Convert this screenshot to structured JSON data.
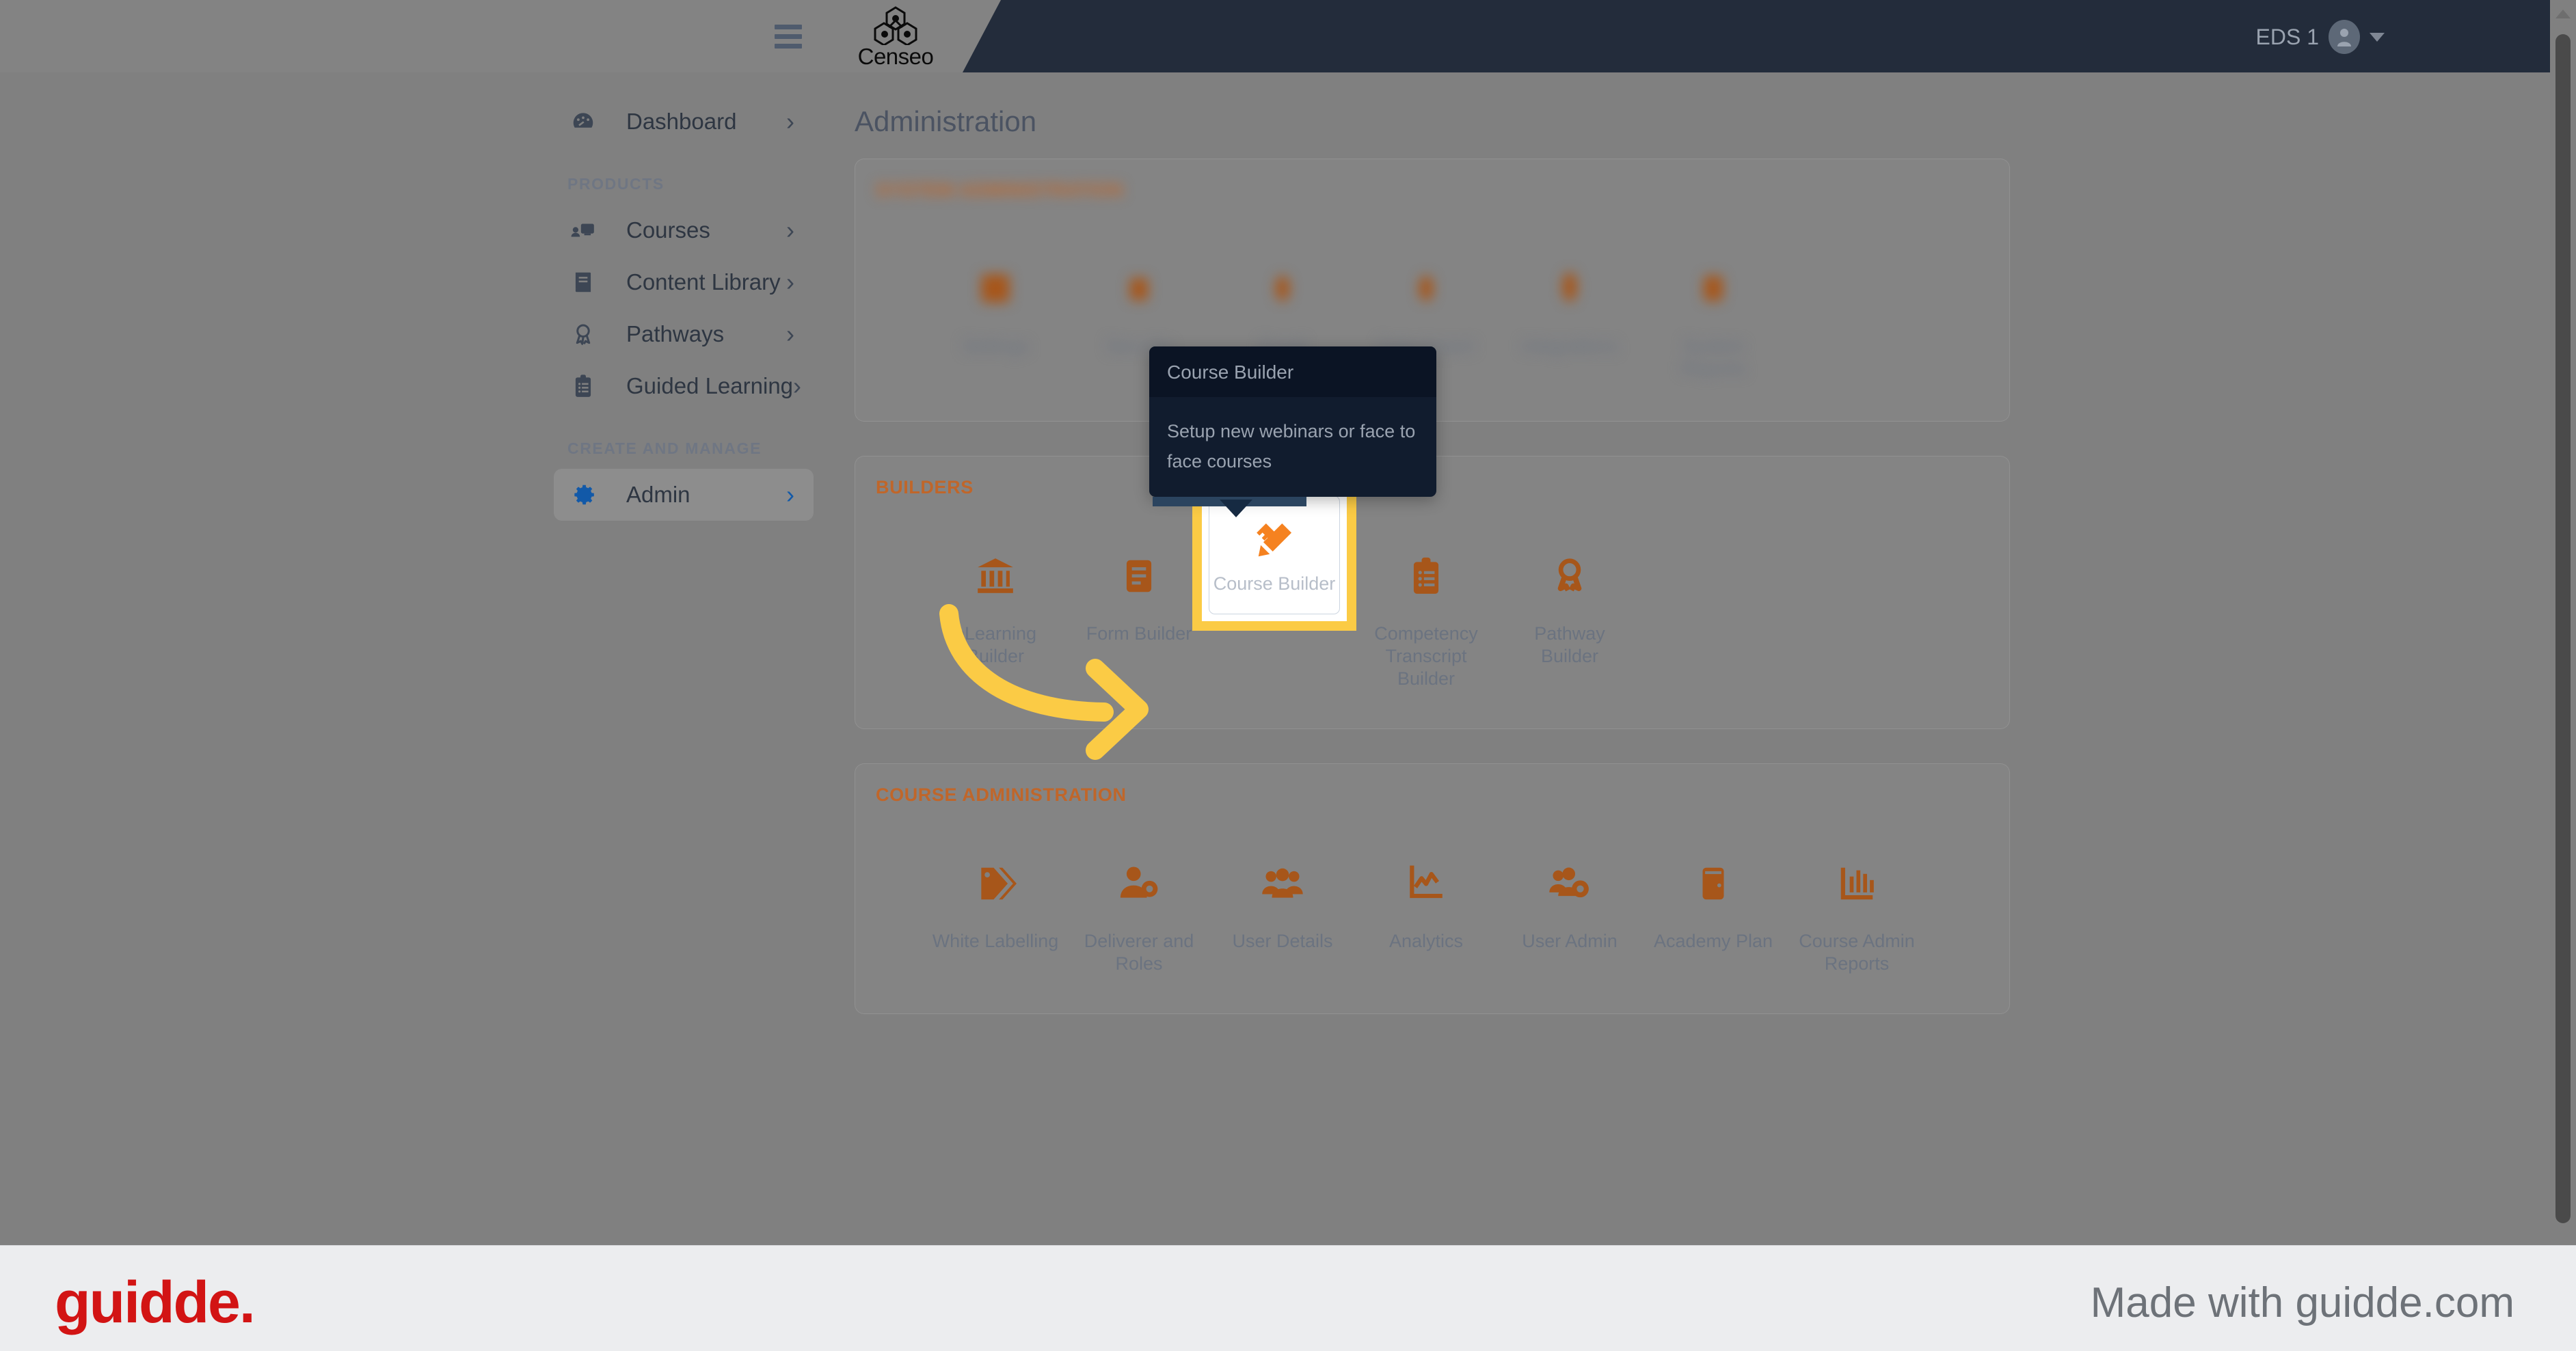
{
  "topbar": {
    "menu_icon": "hamburger-icon",
    "brand_name": "Censeo",
    "brand_logo": "censeo-hexagon-logo",
    "user_name": "EDS 1",
    "avatar_icon": "user-avatar-icon",
    "caret_icon": "chevron-down-icon"
  },
  "sidebar": {
    "items": [
      {
        "label": "Dashboard",
        "icon": "dashboard-gauge-icon",
        "active": false
      },
      {
        "label": "Courses",
        "icon": "courses-screen-icon",
        "active": false
      },
      {
        "label": "Content Library",
        "icon": "book-icon",
        "active": false
      },
      {
        "label": "Pathways",
        "icon": "award-ribbon-icon",
        "active": false
      },
      {
        "label": "Guided Learning",
        "icon": "clipboard-list-icon",
        "active": false
      },
      {
        "label": "Admin",
        "icon": "gear-icon",
        "active": true
      }
    ],
    "sections": {
      "products": "PRODUCTS",
      "create_and_manage": "CREATE AND MANAGE"
    },
    "chevron_icon": "chevron-right-icon"
  },
  "main": {
    "page_title": "Administration",
    "panels": [
      {
        "id": "top-blurred",
        "title": "SYSTEM ADMINISTRATION",
        "blurred": true,
        "tiles": [
          {
            "label": "Settings",
            "icon": "settings-icon"
          },
          {
            "label": "Security",
            "icon": "security-icon"
          },
          {
            "label": "Email",
            "icon": "email-icon"
          },
          {
            "label": "Data Import",
            "icon": "data-import-icon"
          },
          {
            "label": "Integrations",
            "icon": "integrations-icon"
          },
          {
            "label": "System Reports",
            "icon": "system-reports-icon"
          }
        ]
      },
      {
        "id": "builders",
        "title": "BUILDERS",
        "blurred": false,
        "tiles": [
          {
            "label": "eLearning Builder",
            "icon": "bank-columns-icon"
          },
          {
            "label": "Form Builder",
            "icon": "form-icon"
          },
          {
            "label": "Course Builder",
            "icon": "pencil-ruler-icon",
            "highlighted": true
          },
          {
            "label": "Competency Transcript Builder",
            "icon": "clipboard-list-icon"
          },
          {
            "label": "Pathway Builder",
            "icon": "award-ribbon-icon"
          }
        ]
      },
      {
        "id": "course-administration",
        "title": "COURSE ADMINISTRATION",
        "blurred": false,
        "tiles": [
          {
            "label": "White Labelling",
            "icon": "tag-icon"
          },
          {
            "label": "Deliverer and Roles",
            "icon": "user-gear-icon"
          },
          {
            "label": "User Details",
            "icon": "users-group-icon"
          },
          {
            "label": "Analytics",
            "icon": "line-chart-icon"
          },
          {
            "label": "User Admin",
            "icon": "users-gear-icon"
          },
          {
            "label": "Academy Plan",
            "icon": "door-icon"
          },
          {
            "label": "Course Admin Reports",
            "icon": "bar-chart-icon"
          }
        ]
      }
    ]
  },
  "tooltip": {
    "title": "Course Builder",
    "body": "Setup new webinars or face to face courses"
  },
  "annotation": {
    "arrow_icon": "curved-arrow-icon",
    "arrow_color": "#fbcb45",
    "highlight_color": "#fbcb45"
  },
  "footer": {
    "logo_text": "guidde.",
    "made_with_text": "Made with guidde.com"
  },
  "scrollbar": {
    "up_arrow_icon": "scroll-up-arrow-icon",
    "thumb": "scroll-thumb"
  },
  "colors": {
    "accent_orange": "#a7561a",
    "brand_orange": "#c0662a",
    "highlight_yellow": "#fbcb45",
    "admin_blue": "#1259a8",
    "guidde_red": "#d21414",
    "tooltip_bg": "#111c2e"
  }
}
